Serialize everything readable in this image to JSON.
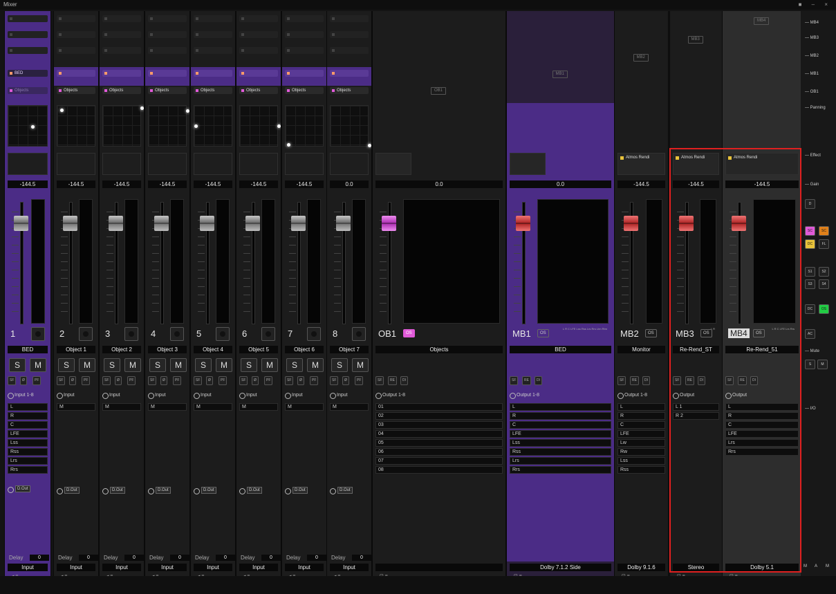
{
  "window": {
    "title": "Mixer",
    "controls": "■ – ×"
  },
  "sidebar": {
    "items": [
      "MB4",
      "MB3",
      "MB2",
      "MB1",
      "OB1",
      "Panning",
      "Effect",
      "Gain",
      "Mute",
      "I/O"
    ],
    "mute_buttons": [
      "S",
      "M"
    ],
    "solo_buttons": [
      "SC",
      "SC",
      "DC",
      "FL",
      "S1",
      "S2",
      "S3",
      "S4",
      "DC",
      "OS",
      "AC"
    ],
    "bottom_buttons": [
      "M",
      "A",
      "M"
    ]
  },
  "send_slots": [
    "Re-Rend_ST",
    "Re-Rend_51",
    "Monitor",
    "BED",
    "Objects"
  ],
  "bus_labels": [
    "OB1",
    "MB1",
    "MB2",
    "MB3",
    "MB4"
  ],
  "strips": [
    {
      "num": "1",
      "name": "BED",
      "gain": "-144.5",
      "bus": "BED",
      "io_head": "Input 1-8",
      "channels": [
        "L",
        "R",
        "C",
        "LFE",
        "Lss",
        "Rss",
        "Lrs",
        "Rrs"
      ],
      "dout": "D.Out",
      "delay_label": "Delay",
      "delay": "0",
      "foot": "Input"
    },
    {
      "num": "2",
      "name": "Object 1",
      "gain": "-144.5",
      "bus": "Objects",
      "io_head": "Input",
      "channels": [
        "M"
      ],
      "dout": "D.Out",
      "delay_label": "Delay",
      "delay": "0",
      "foot": "Input"
    },
    {
      "num": "3",
      "name": "Object 2",
      "gain": "-144.5",
      "bus": "Objects",
      "io_head": "Input",
      "channels": [
        "M"
      ],
      "dout": "",
      "delay_label": "Delay",
      "delay": "0",
      "foot": "Input"
    },
    {
      "num": "4",
      "name": "Object 3",
      "gain": "-144.5",
      "bus": "Objects",
      "io_head": "Input",
      "channels": [
        "M"
      ],
      "dout": "D.Out",
      "delay_label": "Delay",
      "delay": "0",
      "foot": "Input"
    },
    {
      "num": "5",
      "name": "Object 4",
      "gain": "-144.5",
      "bus": "Objects",
      "io_head": "Input",
      "channels": [
        "M"
      ],
      "dout": "",
      "delay_label": "Delay",
      "delay": "0",
      "foot": "Input"
    },
    {
      "num": "6",
      "name": "Object 5",
      "gain": "-144.5",
      "bus": "Objects",
      "io_head": "Input",
      "channels": [
        "M"
      ],
      "dout": "D.Out",
      "delay_label": "Delay",
      "delay": "0",
      "foot": "Input"
    },
    {
      "num": "7",
      "name": "Object 6",
      "gain": "-144.5",
      "bus": "Objects",
      "io_head": "Input",
      "channels": [
        "M"
      ],
      "dout": "D.Out",
      "delay_label": "Delay",
      "delay": "0",
      "foot": "Input"
    },
    {
      "num": "8",
      "name": "Object 7",
      "gain": "0.0",
      "bus": "Objects",
      "io_head": "Input",
      "channels": [
        "M"
      ],
      "dout": "D.Out",
      "delay_label": "Delay",
      "delay": "0",
      "foot": "Input"
    }
  ],
  "buses": [
    {
      "num": "OB1",
      "badge": "OS",
      "name": "Objects",
      "gain": "0.0",
      "io_head": "Output 1-8",
      "channels": [
        "01",
        "02",
        "03",
        "04",
        "05",
        "06",
        "07",
        "08"
      ],
      "foot": "",
      "fx": ""
    },
    {
      "num": "MB1",
      "badge": "OS",
      "name": "BED",
      "gain": "0.0",
      "io_head": "Output 1-8",
      "channels": [
        "L",
        "R",
        "C",
        "LFE",
        "Lss",
        "Rss",
        "Lrs",
        "Rrs"
      ],
      "foot": "Dolby 7.1.2 Side",
      "fx": "",
      "meter_labels": "L  R  C  LFE Lss Rss Lrs Rrs Ltm Rtm"
    },
    {
      "num": "MB2",
      "badge": "OS",
      "name": "Monitor",
      "gain": "-144.5",
      "io_head": "Output 1-8",
      "channels": [
        "L",
        "R",
        "C",
        "LFE",
        "Lw",
        "Rw",
        "Lss",
        "Rss"
      ],
      "foot": "Dolby 9.1.6",
      "fx": "Atmos Rendi"
    },
    {
      "num": "MB3",
      "badge": "OS",
      "name": "Re-Rend_ST",
      "gain": "-144.5",
      "io_head": "Output",
      "channels": [
        "L          1",
        "R          2"
      ],
      "foot": "Stereo",
      "fx": "Atmos Rendi",
      "meter_labels": "L  R"
    },
    {
      "num": "MB4",
      "badge": "OS",
      "name": "Re-Rend_51",
      "gain": "-144.5",
      "io_head": "Output",
      "channels": [
        "L",
        "R",
        "C",
        "LFE",
        "Lrs",
        "Rrs"
      ],
      "foot": "Dolby 5.1",
      "fx": "Atmos Rendi",
      "meter_labels": "L  R  C  LFE Lrs Rrs"
    }
  ],
  "buttons": {
    "solo": "S",
    "mute": "M",
    "sf": "SF",
    "phase": "Ø",
    "pf": "PF",
    "re": "RE",
    "di": "DI"
  },
  "colors": {
    "purple": "#4b2c86",
    "selection": "#e02020",
    "accent_pink": "#e05ad8",
    "fader_red": "#b22a2a"
  }
}
